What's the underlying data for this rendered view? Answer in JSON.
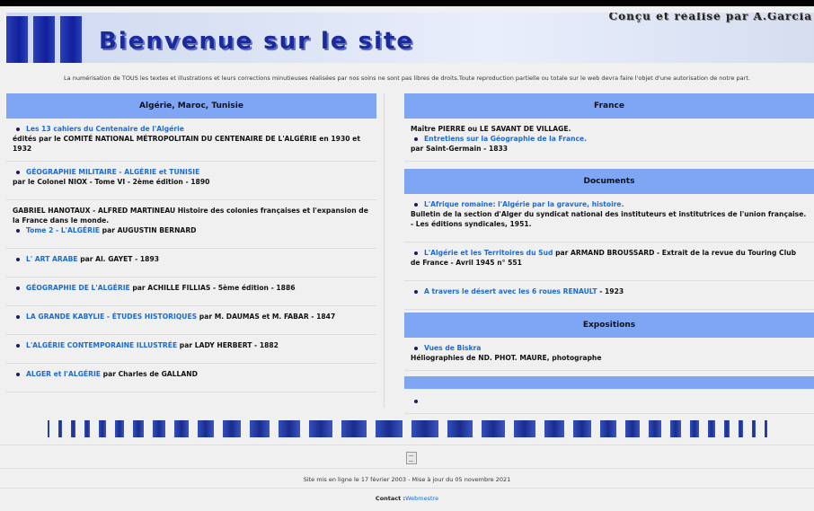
{
  "banner": {
    "title": "Bienvenue sur le site",
    "credit": "Conçu et réalisé par A.Garcia"
  },
  "notice": "La numérisation de TOUS les textes et illustrations et leurs corrections minutieuses réalisées par nos soins ne sont pas libres de droits.Toute reproduction partielle ou totale sur le web devra faire l'objet d'une autorisation de notre part.",
  "left": {
    "heading": "Algérie, Maroc, Tunisie",
    "items": [
      {
        "pre": "",
        "link": "Les 13 cahiers du Centenaire de l'Algérie",
        "inline": "",
        "post": "édités par le COMITÉ NATIONAL MÉTROPOLITAIN DU CENTENAIRE DE L'ALGÉRIE en 1930 et 1932"
      },
      {
        "pre": "",
        "link": "GÉOGRAPHIE MILITAIRE - ALGÉRIE et TUNISIE",
        "inline": "",
        "post": "par le Colonel NIOX - Tome VI - 2ème édition - 1890"
      },
      {
        "pre": "GABRIEL HANOTAUX - ALFRED MARTINEAU Histoire des colonies françaises et l'expansion de la France dans le monde.",
        "link": "Tome 2 - L'ALGÉRIE",
        "inline": " par AUGUSTIN BERNARD",
        "post": ""
      },
      {
        "pre": "",
        "link": "L' ART ARABE",
        "inline": " par Al. GAYET - 1893",
        "post": ""
      },
      {
        "pre": "",
        "link": "GÉOGRAPHIE DE L'ALGÉRIE",
        "inline": " par ACHILLE FILLIAS - 5ème édition - 1886",
        "post": ""
      },
      {
        "pre": "",
        "link": "LA GRANDE KABYLIE - ÉTUDES HISTORIQUES",
        "inline": " par M. DAUMAS et M. FABAR - 1847",
        "post": ""
      },
      {
        "pre": "",
        "link": "L'ALGÉRIE CONTEMPORAINE ILLUSTRÉE",
        "inline": " par LADY HERBERT - 1882",
        "post": ""
      },
      {
        "pre": "",
        "link": "ALGER et l'ALGÉRIE",
        "inline": " par Charles de GALLAND",
        "post": ""
      }
    ]
  },
  "right": {
    "france": {
      "heading": "France",
      "items": [
        {
          "pre": "Maître PIERRE ou LE SAVANT DE VILLAGE.",
          "link": "Entretiens sur la Géographie de la France.",
          "inline": "",
          "post": "par Saint-Germain - 1833"
        }
      ]
    },
    "documents": {
      "heading": "Documents",
      "items": [
        {
          "pre": "",
          "link": "L'Afrique romaine: l'Algérie par la gravure, histoire.",
          "inline": "",
          "post": "Bulletin de la section d'Alger du syndicat national des instituteurs et institutrices de l'union française. - Les éditions syndicales, 1951."
        },
        {
          "pre": "",
          "link": "L'Algérie et les Territoires du Sud",
          "inline": " par ARMAND BROUSSARD - Extrait de la revue du Touring Club de France - Avril 1945 n° 551",
          "post": ""
        },
        {
          "pre": "",
          "link": "A travers le désert avec les 6 roues RENAULT",
          "inline": " - 1923",
          "post": ""
        }
      ]
    },
    "expositions": {
      "heading": "Expositions",
      "items": [
        {
          "pre": "",
          "link": "Vues de Biskra",
          "inline": "",
          "post": "Héliographies de ND. PHOT. MAURE, photographe"
        }
      ]
    }
  },
  "footer": {
    "dates": "Site mis en ligne le 17 février 2003 - Mise à jour du 05 novembre 2021",
    "contact_label": "Contact :",
    "contact_link": "Webmestre"
  },
  "colors": {
    "section_header": "#7ea6f5",
    "link": "#1b6bd6",
    "banner_text": "#1b2a9a"
  }
}
